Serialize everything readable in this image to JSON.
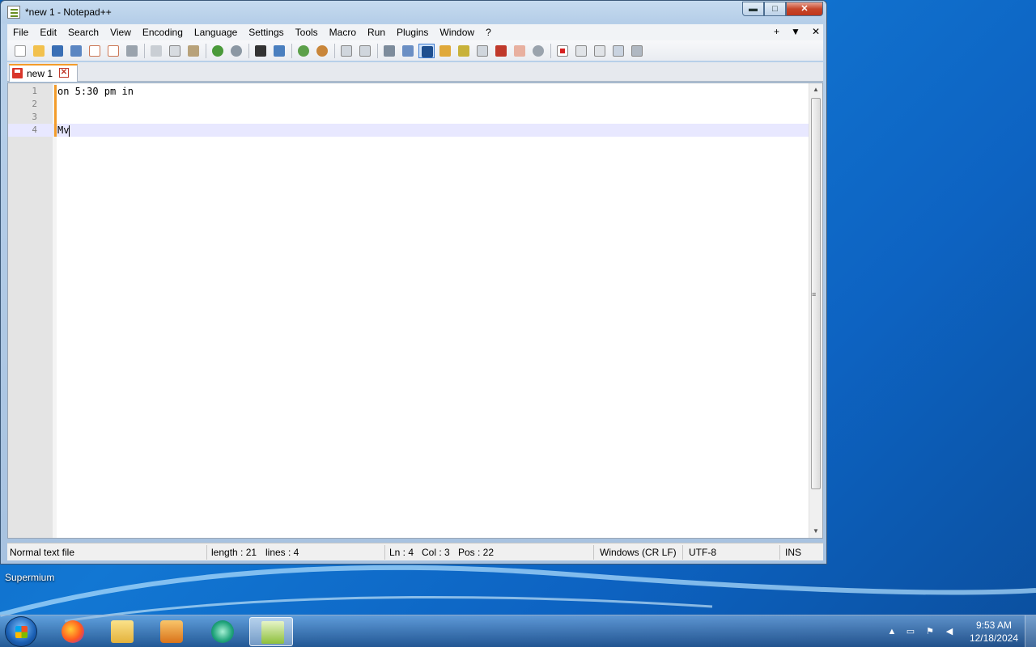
{
  "window": {
    "title": "*new 1 - Notepad++",
    "minimize_label": "▬",
    "maximize_label": "□",
    "close_label": "✕"
  },
  "menu": {
    "items": [
      "File",
      "Edit",
      "Search",
      "View",
      "Encoding",
      "Language",
      "Settings",
      "Tools",
      "Macro",
      "Run",
      "Plugins",
      "Window",
      "?"
    ],
    "right_items": [
      "+",
      "▼",
      "✕"
    ]
  },
  "toolbar": {
    "icons": [
      "new-file-icon",
      "open-file-icon",
      "save-icon",
      "save-all-icon",
      "close-icon",
      "close-all-icon",
      "print-icon",
      "cut-icon",
      "copy-icon",
      "paste-icon",
      "undo-icon",
      "redo-icon",
      "find-icon",
      "replace-icon",
      "zoom-in-icon",
      "zoom-out-icon",
      "sync-vertical-icon",
      "sync-horizontal-icon",
      "word-wrap-icon",
      "show-all-characters-icon",
      "indent-guide-icon",
      "user-defined-language-icon",
      "document-map-icon",
      "document-list-icon",
      "function-list-icon",
      "folder-as-workspace-icon",
      "monitoring-icon",
      "record-macro-icon",
      "stop-recording-icon",
      "playback-icon",
      "run-macro-multiple-icon",
      "save-macro-icon"
    ]
  },
  "tabs": [
    {
      "label": "new 1",
      "close_label": "✕"
    }
  ],
  "editor": {
    "lines": [
      {
        "number": "1",
        "text": "on 5:30 pm in"
      },
      {
        "number": "2",
        "text": ""
      },
      {
        "number": "3",
        "text": ""
      },
      {
        "number": "4",
        "text": "Mv"
      }
    ],
    "current_line": 4
  },
  "status": {
    "file_type": "Normal text file",
    "length": "length : 21",
    "lines": "lines : 4",
    "ln": "Ln : 4",
    "col": "Col : 3",
    "pos": "Pos : 22",
    "eol": "Windows (CR LF)",
    "encoding": "UTF-8",
    "mode": "INS"
  },
  "desktop": {
    "label": "Supermium"
  },
  "taskbar": {
    "apps": [
      "firefox-icon",
      "file-explorer-icon",
      "media-player-icon",
      "chat-app-icon",
      "notepad-plus-plus-icon"
    ],
    "active_app": "notepad-plus-plus-icon",
    "tray_arrow": "▲",
    "time": "9:53 AM",
    "date": "12/18/2024"
  }
}
